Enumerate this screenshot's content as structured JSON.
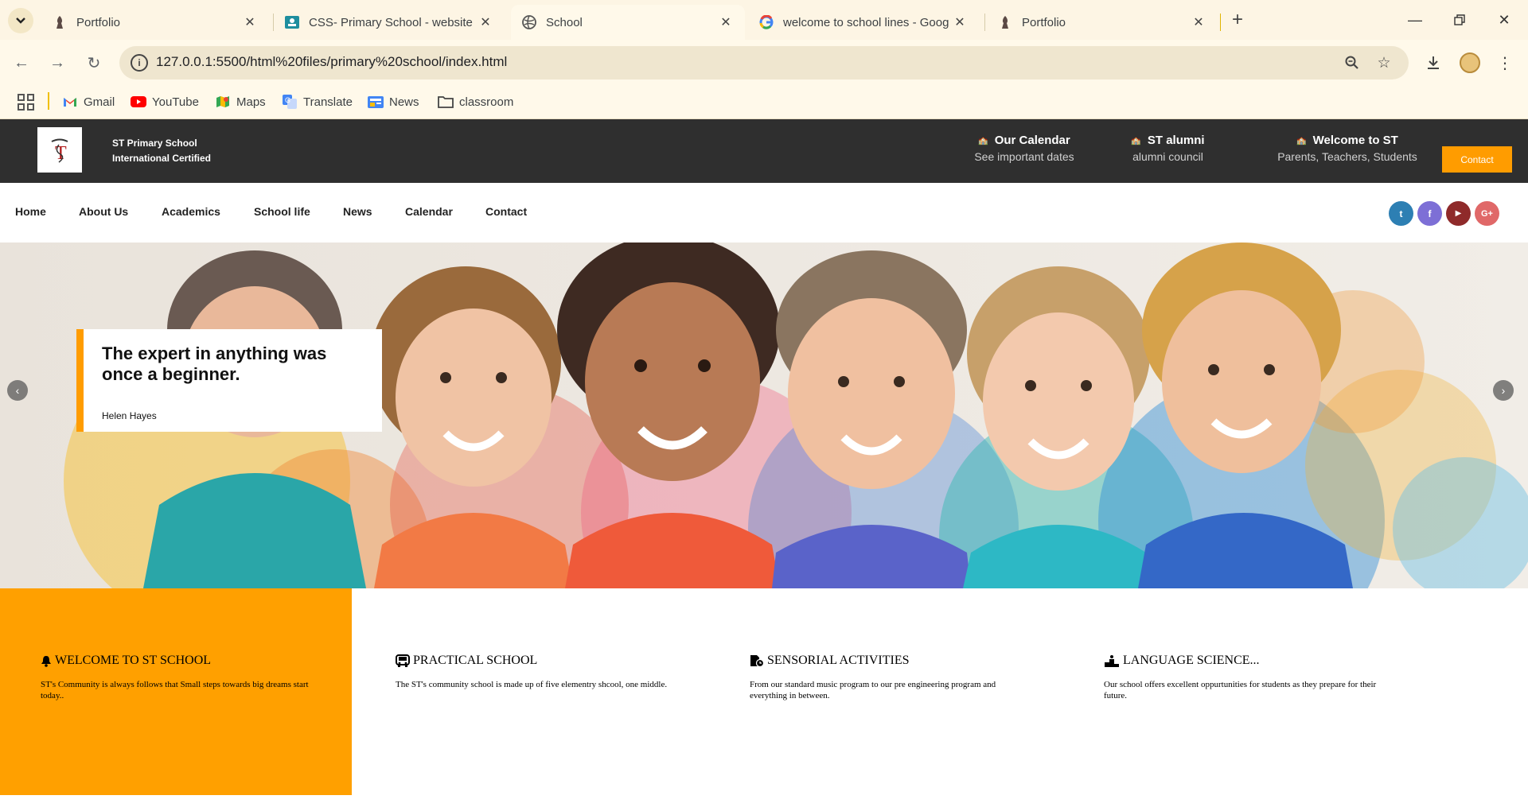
{
  "browser": {
    "tabs": [
      {
        "title": "Portfolio",
        "icon": "figure-icon",
        "active": false
      },
      {
        "title": "CSS- Primary School - website",
        "icon": "classroom-icon",
        "active": false
      },
      {
        "title": "School",
        "icon": "globe-icon",
        "active": true
      },
      {
        "title": "welcome to school lines - Goog",
        "icon": "google-icon",
        "active": false
      },
      {
        "title": "Portfolio",
        "icon": "figure-icon",
        "active": false
      }
    ],
    "url": "127.0.0.1:5500/html%20files/primary%20school/index.html",
    "bookmarks": [
      {
        "label": "Gmail",
        "icon": "gmail-icon"
      },
      {
        "label": "YouTube",
        "icon": "youtube-icon"
      },
      {
        "label": "Maps",
        "icon": "maps-icon"
      },
      {
        "label": "Translate",
        "icon": "translate-icon"
      },
      {
        "label": "News",
        "icon": "news-icon"
      },
      {
        "label": "classroom",
        "icon": "folder-icon"
      }
    ]
  },
  "site": {
    "logo_letter": "T",
    "name": "ST Primary School",
    "subtitle": "International Certified",
    "header_info": [
      {
        "title": "Our Calendar",
        "sub": "See important dates"
      },
      {
        "title": "ST alumni",
        "sub": "alumni council"
      },
      {
        "title": "Welcome to ST",
        "sub": "Parents, Teachers, Students"
      }
    ],
    "contact_button": "Contact",
    "nav": [
      "Home",
      "About Us",
      "Academics",
      "School life",
      "News",
      "Calendar",
      "Contact"
    ],
    "social": [
      {
        "name": "twitter",
        "glyph": "t",
        "color": "#2d7fb3"
      },
      {
        "name": "facebook",
        "glyph": "f",
        "color": "#7d6fd6"
      },
      {
        "name": "youtube",
        "glyph": "▶",
        "color": "#8f2a2a"
      },
      {
        "name": "google-plus",
        "glyph": "G+",
        "color": "#e06868"
      }
    ],
    "hero": {
      "quote": "The expert in anything was once a beginner.",
      "author": "Helen Hayes",
      "prev": "‹",
      "next": "›"
    },
    "features": [
      {
        "title": "WELCOME TO ST SCHOOL",
        "icon": "bell-icon",
        "text": "ST's Community is always follows that Small steps towards big dreams start today.."
      },
      {
        "title": "PRACTICAL SCHOOL",
        "icon": "bus-icon",
        "text": "The ST's community school is made up of five elementry shcool, one middle."
      },
      {
        "title": "SENSORIAL ACTIVITIES",
        "icon": "file-clock-icon",
        "text": "From our standard music program to our pre engineering program and everything in between."
      },
      {
        "title": "LANGUAGE SCIENCE...",
        "icon": "podium-icon",
        "text": "Our school offers excellent oppurtunities for students as they prepare for their future."
      }
    ],
    "colors": {
      "accent": "#ff9c00",
      "header_bg": "#2f2f2f",
      "feature_bg": "#ffa000"
    }
  }
}
